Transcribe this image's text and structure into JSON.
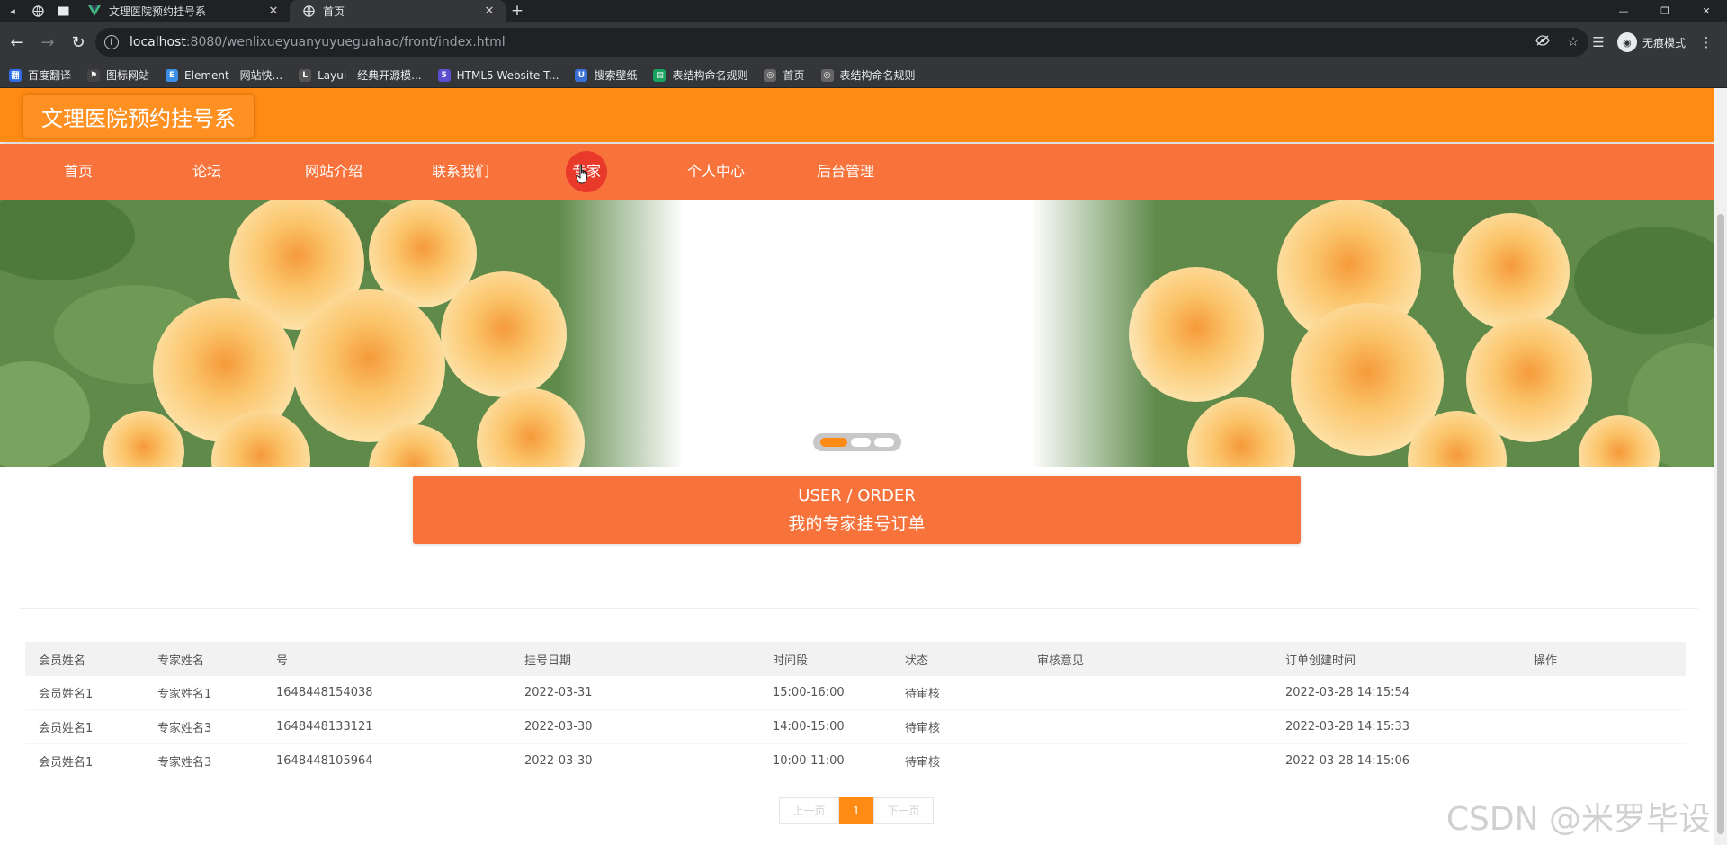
{
  "browser": {
    "tabs": [
      {
        "title": "文理医院预约挂号系",
        "active": false
      },
      {
        "title": "首页",
        "active": true
      }
    ],
    "url_host": "localhost",
    "url_rest": ":8080/wenlixueyuanyuyueguahao/front/index.html",
    "profile_label": "无痕模式",
    "bookmarks": [
      {
        "label": "百度翻译",
        "color": "#2e6ce6"
      },
      {
        "label": "图标网站",
        "color": "#444444"
      },
      {
        "label": "Element - 网站快...",
        "color": "#3a8ee6"
      },
      {
        "label": "Layui - 经典开源模...",
        "color": "#555555"
      },
      {
        "label": "HTML5 Website T...",
        "color": "#5a4fcf"
      },
      {
        "label": "搜索壁纸",
        "color": "#3a6fd8"
      },
      {
        "label": "表结构命名规则",
        "color": "#1aa260"
      },
      {
        "label": "首页",
        "color": "#666666"
      },
      {
        "label": "表结构命名规则",
        "color": "#666666"
      }
    ]
  },
  "site": {
    "title": "文理医院预约挂号系",
    "nav": [
      {
        "label": "首页"
      },
      {
        "label": "论坛"
      },
      {
        "label": "网站介绍"
      },
      {
        "label": "联系我们"
      },
      {
        "label": "专家",
        "active": true
      },
      {
        "label": "个人中心"
      },
      {
        "label": "后台管理"
      }
    ],
    "colors": {
      "header": "#ff8a14",
      "nav": "#f7733b",
      "accent": "#e8392b"
    }
  },
  "section": {
    "title_en": "USER / ORDER",
    "title_cn": "我的专家挂号订单"
  },
  "table": {
    "headers": [
      "会员姓名",
      "专家姓名",
      "号",
      "挂号日期",
      "时间段",
      "状态",
      "审核意见",
      "订单创建时间",
      "操作"
    ],
    "rows": [
      [
        "会员姓名1",
        "专家姓名1",
        "1648448154038",
        "2022-03-31",
        "15:00-16:00",
        "待审核",
        "",
        "2022-03-28 14:15:54",
        ""
      ],
      [
        "会员姓名1",
        "专家姓名3",
        "1648448133121",
        "2022-03-30",
        "14:00-15:00",
        "待审核",
        "",
        "2022-03-28 14:15:33",
        ""
      ],
      [
        "会员姓名1",
        "专家姓名3",
        "1648448105964",
        "2022-03-30",
        "10:00-11:00",
        "待审核",
        "",
        "2022-03-28 14:15:06",
        ""
      ]
    ]
  },
  "pager": {
    "prev": "上一页",
    "current": "1",
    "next": "下一页"
  },
  "watermark": "CSDN @米罗毕设"
}
